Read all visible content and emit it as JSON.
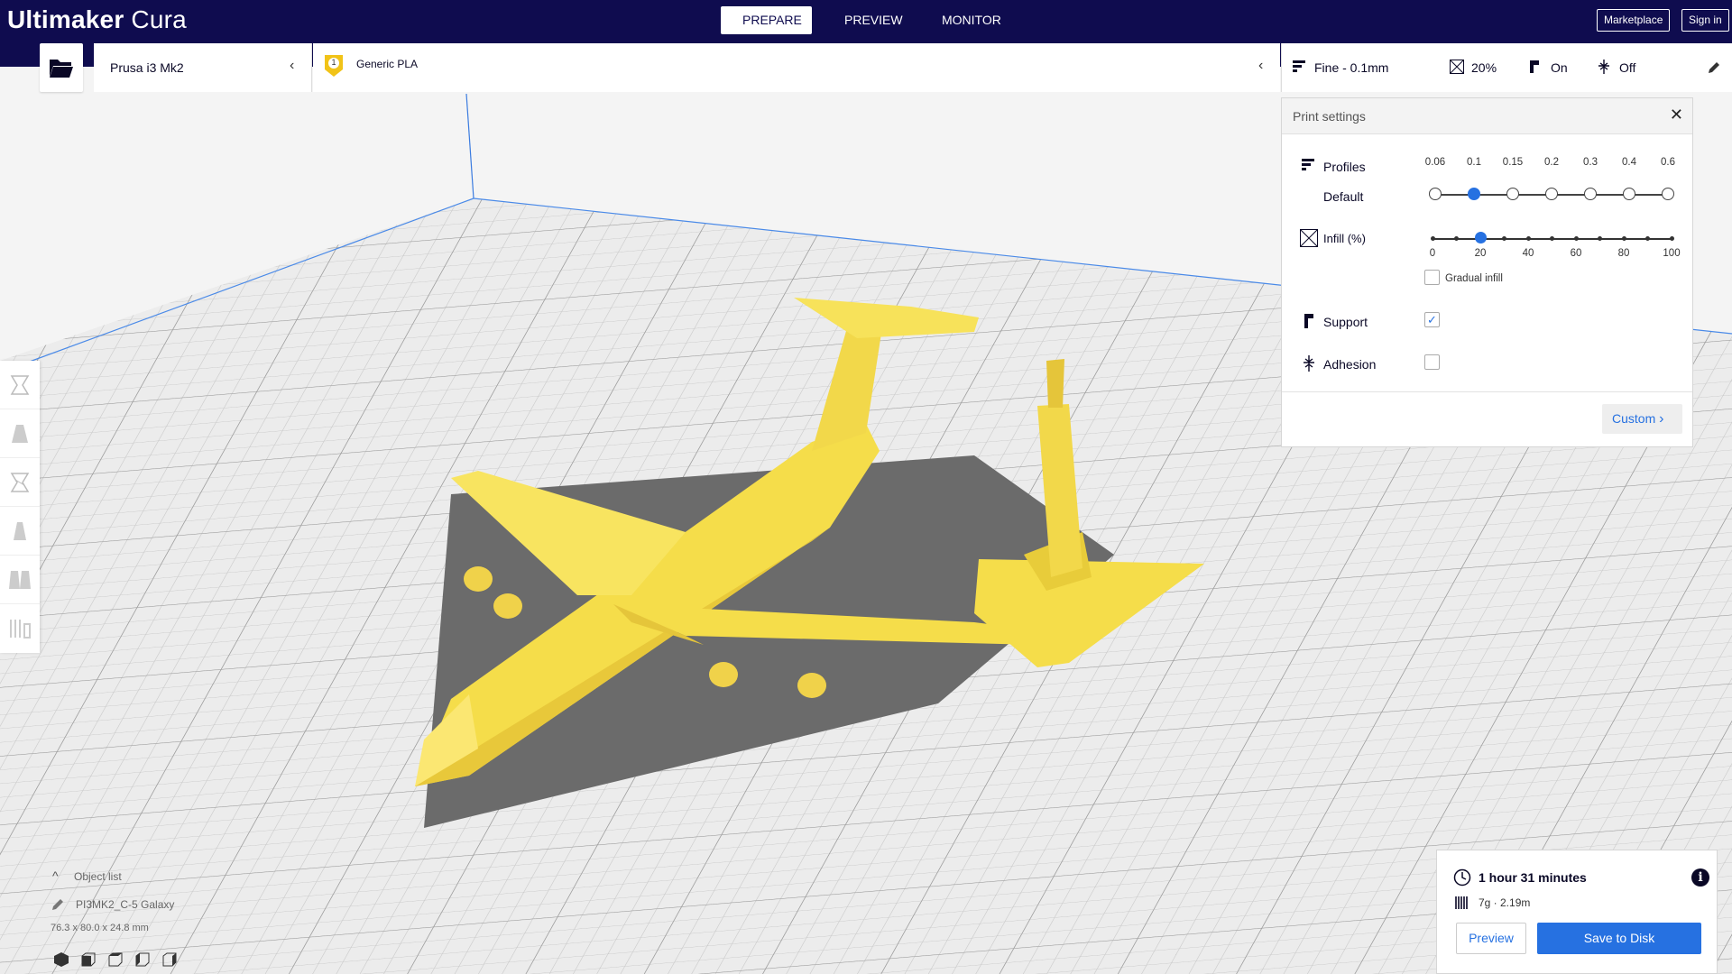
{
  "app": {
    "title_bold": "Ultimaker",
    "title_light": "Cura"
  },
  "stages": {
    "prepare": "PREPARE",
    "preview": "PREVIEW",
    "monitor": "MONITOR"
  },
  "header": {
    "marketplace": "Marketplace",
    "signin": "Sign in"
  },
  "toolbar": {
    "printer": "Prusa i3 Mk2",
    "extruder_number": "1",
    "material": "Generic PLA",
    "profile": "Fine - 0.1mm",
    "infill": "20%",
    "support": "On",
    "adhesion": "Off"
  },
  "print_settings": {
    "title": "Print settings",
    "profiles_label": "Profiles",
    "default_label": "Default",
    "layer_heights": [
      "0.06",
      "0.1",
      "0.15",
      "0.2",
      "0.3",
      "0.4",
      "0.6"
    ],
    "selected_layer_height": "0.1",
    "infill_label": "Infill (%)",
    "infill_ticks": [
      "0",
      "20",
      "40",
      "60",
      "80",
      "100"
    ],
    "infill_value": 20,
    "gradual_infill": "Gradual infill",
    "gradual_checked": false,
    "support_label": "Support",
    "support_checked": true,
    "adhesion_label": "Adhesion",
    "adhesion_checked": false,
    "custom_button": "Custom"
  },
  "object_list": {
    "header": "Object list",
    "object_name": "PI3MK2_C-5 Galaxy",
    "dimensions": "76.3 x 80.0 x 24.8 mm"
  },
  "job": {
    "time": "1 hour 31 minutes",
    "material_usage": "7g · 2.19m",
    "preview_button": "Preview",
    "save_button": "Save to Disk"
  },
  "colors": {
    "header": "#0f0c4f",
    "accent": "#2671e1",
    "model": "#f5e15a",
    "shadow": "#6b6b6b"
  }
}
